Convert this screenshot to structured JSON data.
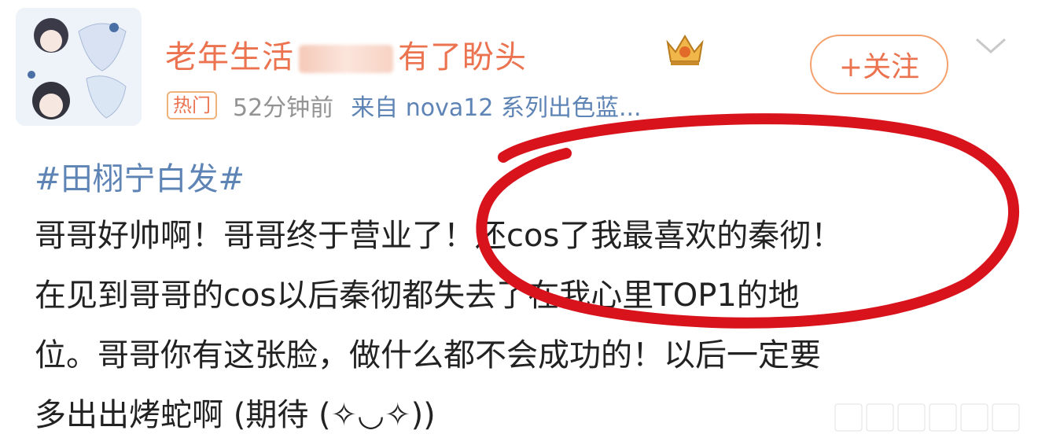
{
  "user": {
    "name_start": "老年生活",
    "name_end": "有了盼头",
    "avatar_icon": "avatar-image",
    "badge_icon": "crown-icon"
  },
  "follow_button": {
    "label": "+关注"
  },
  "meta": {
    "tag": "热门",
    "time": "52分钟前",
    "source": "来自 nova12 系列出色蓝..."
  },
  "post": {
    "hashtag": "#田栩宁白发#",
    "lines": [
      "哥哥好帅啊！哥哥终于营业了！还cos了我最喜欢的秦彻！",
      "在见到哥哥的cos以后秦彻都失去了在我心里TOP1的地",
      "位。哥哥你有这张脸，做什么都不会成功的！以后一定要",
      "多出出烤蛇啊 (期待 (✧◡✧))"
    ]
  },
  "colors": {
    "accent": "#eb7350",
    "link": "#5d84b5",
    "annotation": "#d8131c"
  }
}
